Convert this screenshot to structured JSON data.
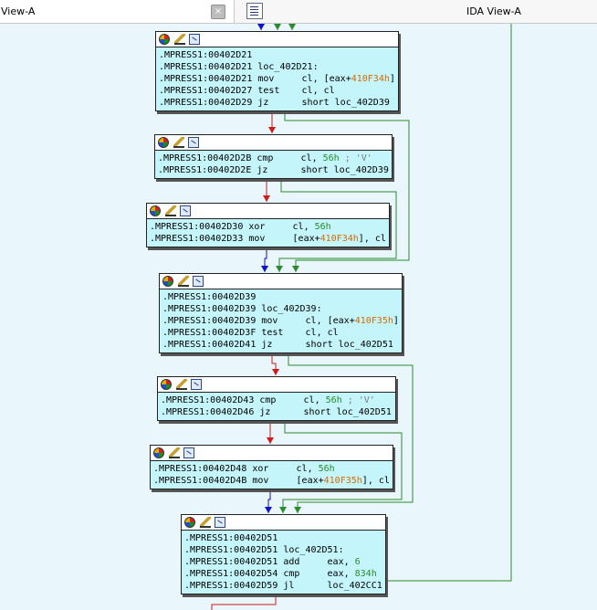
{
  "tabs": {
    "left_label": "View-A",
    "close_glyph": "×",
    "right_label": "IDA View-A"
  },
  "colors": {
    "background": "#e9f6fb",
    "node_fill": "#c4f5fb",
    "edge_true": "#2b8a2b",
    "edge_false": "#d01a1a",
    "edge_uncond": "#1010d0",
    "immediate": "#2a8a2a",
    "offset": "#d86a00"
  },
  "nodes": [
    {
      "lines": [
        [
          {
            "t": ".MPRESS1:00402D21"
          }
        ],
        [
          {
            "t": ".MPRESS1:00402D21 loc_402D21:"
          }
        ],
        [
          {
            "t": ".MPRESS1:00402D21 mov     cl, [eax+"
          },
          {
            "t": "410F34h",
            "c": "off"
          },
          {
            "t": "]"
          }
        ],
        [
          {
            "t": ".MPRESS1:00402D27 test    cl, cl"
          }
        ],
        [
          {
            "t": ".MPRESS1:00402D29 jz      short loc_402D39"
          }
        ]
      ]
    },
    {
      "lines": [
        [
          {
            "t": ".MPRESS1:00402D2B cmp     cl, "
          },
          {
            "t": "56h",
            "c": "num"
          },
          {
            "t": " ; 'V'",
            "c": "cmt"
          }
        ],
        [
          {
            "t": ".MPRESS1:00402D2E jz      short loc_402D39"
          }
        ]
      ]
    },
    {
      "lines": [
        [
          {
            "t": ".MPRESS1:00402D30 xor     cl, "
          },
          {
            "t": "56h",
            "c": "num"
          }
        ],
        [
          {
            "t": ".MPRESS1:00402D33 mov     [eax+"
          },
          {
            "t": "410F34h",
            "c": "off"
          },
          {
            "t": "], cl"
          }
        ]
      ]
    },
    {
      "lines": [
        [
          {
            "t": ".MPRESS1:00402D39"
          }
        ],
        [
          {
            "t": ".MPRESS1:00402D39 loc_402D39:"
          }
        ],
        [
          {
            "t": ".MPRESS1:00402D39 mov     cl, [eax+"
          },
          {
            "t": "410F35h",
            "c": "off"
          },
          {
            "t": "]"
          }
        ],
        [
          {
            "t": ".MPRESS1:00402D3F test    cl, cl"
          }
        ],
        [
          {
            "t": ".MPRESS1:00402D41 jz      short loc_402D51"
          }
        ]
      ]
    },
    {
      "lines": [
        [
          {
            "t": ".MPRESS1:00402D43 cmp     cl, "
          },
          {
            "t": "56h",
            "c": "num"
          },
          {
            "t": " ; 'V'",
            "c": "cmt"
          }
        ],
        [
          {
            "t": ".MPRESS1:00402D46 jz      short loc_402D51"
          }
        ]
      ]
    },
    {
      "lines": [
        [
          {
            "t": ".MPRESS1:00402D48 xor     cl, "
          },
          {
            "t": "56h",
            "c": "num"
          }
        ],
        [
          {
            "t": ".MPRESS1:00402D4B mov     [eax+"
          },
          {
            "t": "410F35h",
            "c": "off"
          },
          {
            "t": "], cl"
          }
        ]
      ]
    },
    {
      "lines": [
        [
          {
            "t": ".MPRESS1:00402D51"
          }
        ],
        [
          {
            "t": ".MPRESS1:00402D51 loc_402D51:"
          }
        ],
        [
          {
            "t": ".MPRESS1:00402D51 add     eax, "
          },
          {
            "t": "6",
            "c": "num"
          }
        ],
        [
          {
            "t": ".MPRESS1:00402D54 cmp     eax, "
          },
          {
            "t": "834h",
            "c": "num"
          }
        ],
        [
          {
            "t": ".MPRESS1:00402D59 jl      loc_402CC1"
          }
        ]
      ]
    }
  ]
}
